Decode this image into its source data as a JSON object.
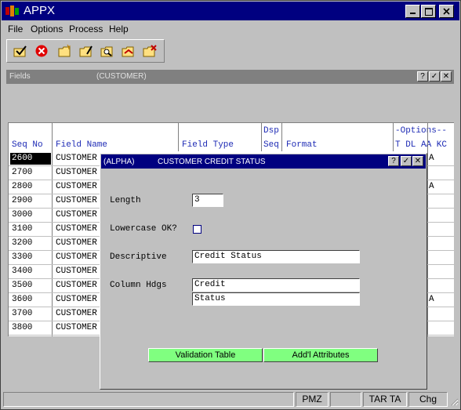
{
  "app": {
    "title": "APPX"
  },
  "menu": [
    "File",
    "Options",
    "Process",
    "Help"
  ],
  "toolbar": {
    "icons": [
      "check-folder-icon",
      "cancel-circle-icon",
      "new-folder-icon",
      "edit-folder-icon",
      "search-folder-icon",
      "open-folder-icon",
      "delete-folder-icon"
    ]
  },
  "child_window": {
    "title_left": "Fields",
    "title_center": "(CUSTOMER)",
    "buttons": [
      "?",
      "✓",
      "✕"
    ]
  },
  "grid": {
    "headers": {
      "seq_no": "Seq No",
      "field_name": "Field Name",
      "field_type": "Field Type",
      "dsp_top": "Dsp",
      "dsp_seq": "Seq",
      "format": "Format",
      "options": "-Options--",
      "opt_cols": "T DL AA KC"
    },
    "rows": [
      {
        "seq": "2600",
        "name": "CUSTOMER",
        "opt": "A"
      },
      {
        "seq": "2700",
        "name": "CUSTOMER",
        "opt": ""
      },
      {
        "seq": "2800",
        "name": "CUSTOMER",
        "opt": "A"
      },
      {
        "seq": "2900",
        "name": "CUSTOMER",
        "opt": ""
      },
      {
        "seq": "3000",
        "name": "CUSTOMER",
        "opt": ""
      },
      {
        "seq": "3100",
        "name": "CUSTOMER",
        "opt": ""
      },
      {
        "seq": "3200",
        "name": "CUSTOMER",
        "opt": ""
      },
      {
        "seq": "3300",
        "name": "CUSTOMER",
        "opt": ""
      },
      {
        "seq": "3400",
        "name": "CUSTOMER",
        "opt": ""
      },
      {
        "seq": "3500",
        "name": "CUSTOMER",
        "opt": ""
      },
      {
        "seq": "3600",
        "name": "CUSTOMER",
        "opt": "A"
      },
      {
        "seq": "3700",
        "name": "CUSTOMER",
        "opt": ""
      },
      {
        "seq": "3800",
        "name": "CUSTOMER",
        "opt": ""
      }
    ]
  },
  "dialog": {
    "title_left": "(ALPHA)",
    "title_center": "CUSTOMER CREDIT STATUS",
    "length_label": "Length",
    "length_value": "3",
    "lowercase_label": "Lowercase OK?",
    "lowercase_checked": false,
    "descriptive_label": "Descriptive",
    "descriptive_value": "Credit Status",
    "column_hdgs_label": "Column Hdgs",
    "column_hdg_1": "Credit",
    "column_hdg_2": "Status",
    "validation_button": "Validation Table",
    "attributes_button": "Add'l Attributes",
    "button_color": "#80ff80"
  },
  "status": {
    "panels": [
      "",
      "PMZ",
      "",
      "TAR TA",
      "Chg"
    ]
  }
}
